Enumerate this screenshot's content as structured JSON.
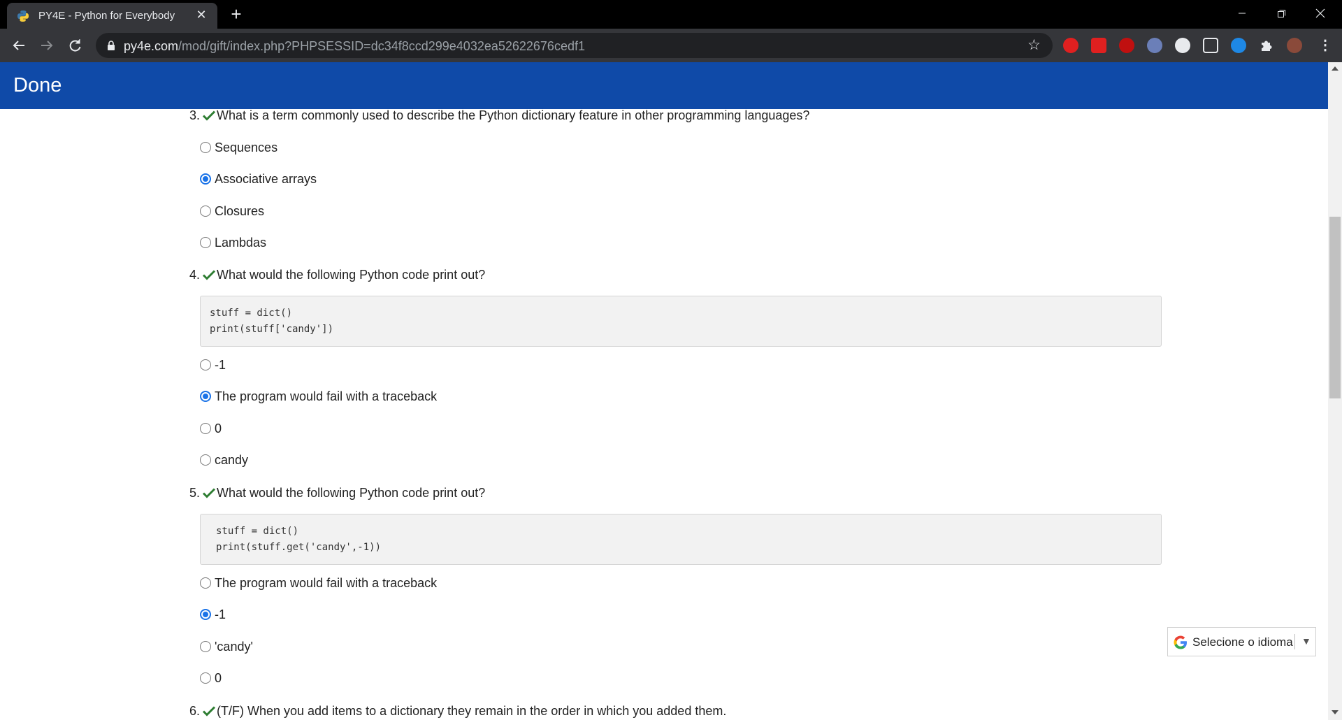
{
  "browser": {
    "tab_title": "PY4E - Python for Everybody",
    "url_host": "py4e.com",
    "url_path": "/mod/gift/index.php?PHPSESSID=dc34f8ccd299e4032ea52622676cedf1"
  },
  "page": {
    "brand": "Done"
  },
  "questions": [
    {
      "number": "3.",
      "text": "What is a term commonly used to describe the Python dictionary feature in other programming languages?",
      "options": [
        "Sequences",
        "Associative arrays",
        "Closures",
        "Lambdas"
      ],
      "selected": 1
    },
    {
      "number": "4.",
      "text": "What would the following Python code print out?",
      "code": [
        "stuff = dict()",
        "print(stuff['candy'])"
      ],
      "options": [
        "-1",
        "The program would fail with a traceback",
        "0",
        "candy"
      ],
      "selected": 1
    },
    {
      "number": "5.",
      "text": "What would the following Python code print out?",
      "code": [
        "stuff = dict()",
        "print(stuff.get('candy',-1))"
      ],
      "options": [
        "The program would fail with a traceback",
        "-1",
        "'candy'",
        "0"
      ],
      "selected": 1
    },
    {
      "number": "6.",
      "text": "(T/F) When you add items to a dictionary they remain in the order in which you added them."
    }
  ],
  "translate_widget": {
    "label": "Selecione o idioma",
    "arrow": "▼"
  },
  "colors": {
    "navbar": "#0f4aa8",
    "check": "#2e7d32",
    "radio_selected": "#1a73e8"
  }
}
